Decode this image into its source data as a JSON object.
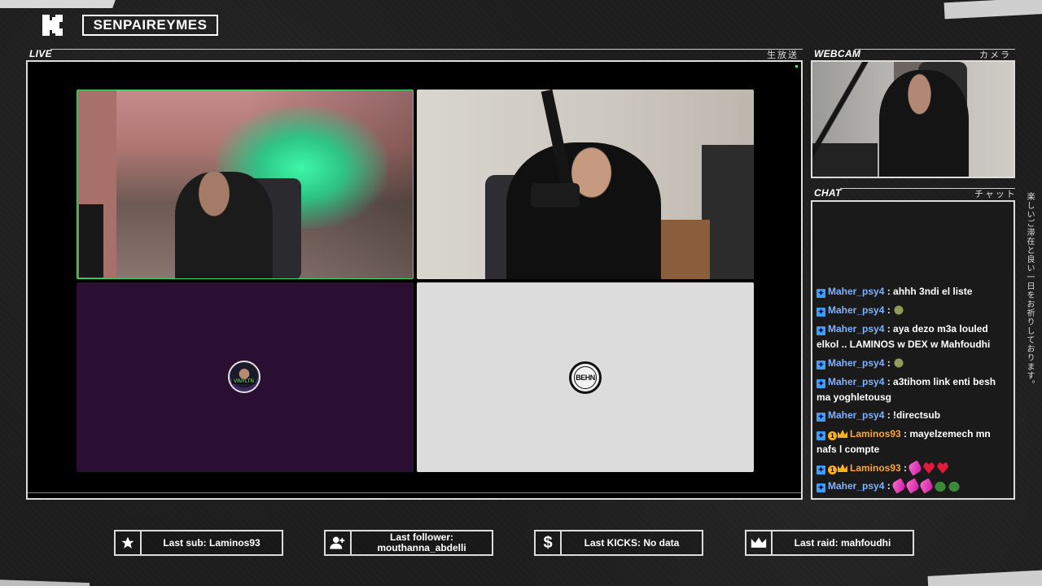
{
  "channel": {
    "name": "SENPAIREYMES"
  },
  "live_panel": {
    "label": "LIVE",
    "jp_label": "生放送"
  },
  "webcam_panel": {
    "label": "WEBCAM",
    "jp_label": "カメラ"
  },
  "chat_panel": {
    "label": "CHAT",
    "jp_label": "チャット",
    "messages": [
      {
        "user": "Maher_psy4",
        "text": ": ahhh 3ndi el liste"
      },
      {
        "user": "Maher_psy4",
        "text": ":"
      },
      {
        "user": "Maher_psy4",
        "text": ": aya dezo m3a louled elkol .. LAMINOS w DEX w Mahfoudhi"
      },
      {
        "user": "Maher_psy4",
        "text": ":"
      },
      {
        "user": "Maher_psy4",
        "text": ": a3tihom link enti besh ma yoghletousg"
      },
      {
        "user": "Maher_psy4",
        "text": ": !directsub"
      },
      {
        "user": "Laminos93",
        "text": ": mayelzemech mn nafs l compte"
      },
      {
        "user": "Laminos93",
        "text": ":"
      },
      {
        "user": "Maher_psy4",
        "text": ":"
      }
    ]
  },
  "side_text": "楽しいご滞在と良い一日をお祈りしております。",
  "video_tiles": {
    "avatar_badge": "VINYLTN"
  },
  "stats": {
    "last_sub": "Last sub: Laminos93",
    "last_follower_line1": "Last follower:",
    "last_follower_line2": "mouthanna_abdelli",
    "last_kicks": "Last KICKS: No data",
    "last_raid": "Last raid: mahfoudhi"
  },
  "icons": {
    "logo": "kick-logo-icon",
    "sub": "star-icon",
    "follower": "user-add-icon",
    "kicks": "dollar-icon",
    "raid": "crown-icon"
  },
  "colors": {
    "user_blue": "#7fb2ff",
    "user_orange": "#ffa530",
    "kick_badge": "#3aa0ff",
    "tile_purple": "#2a0f33",
    "active_speaker_border": "#3fd66a"
  }
}
